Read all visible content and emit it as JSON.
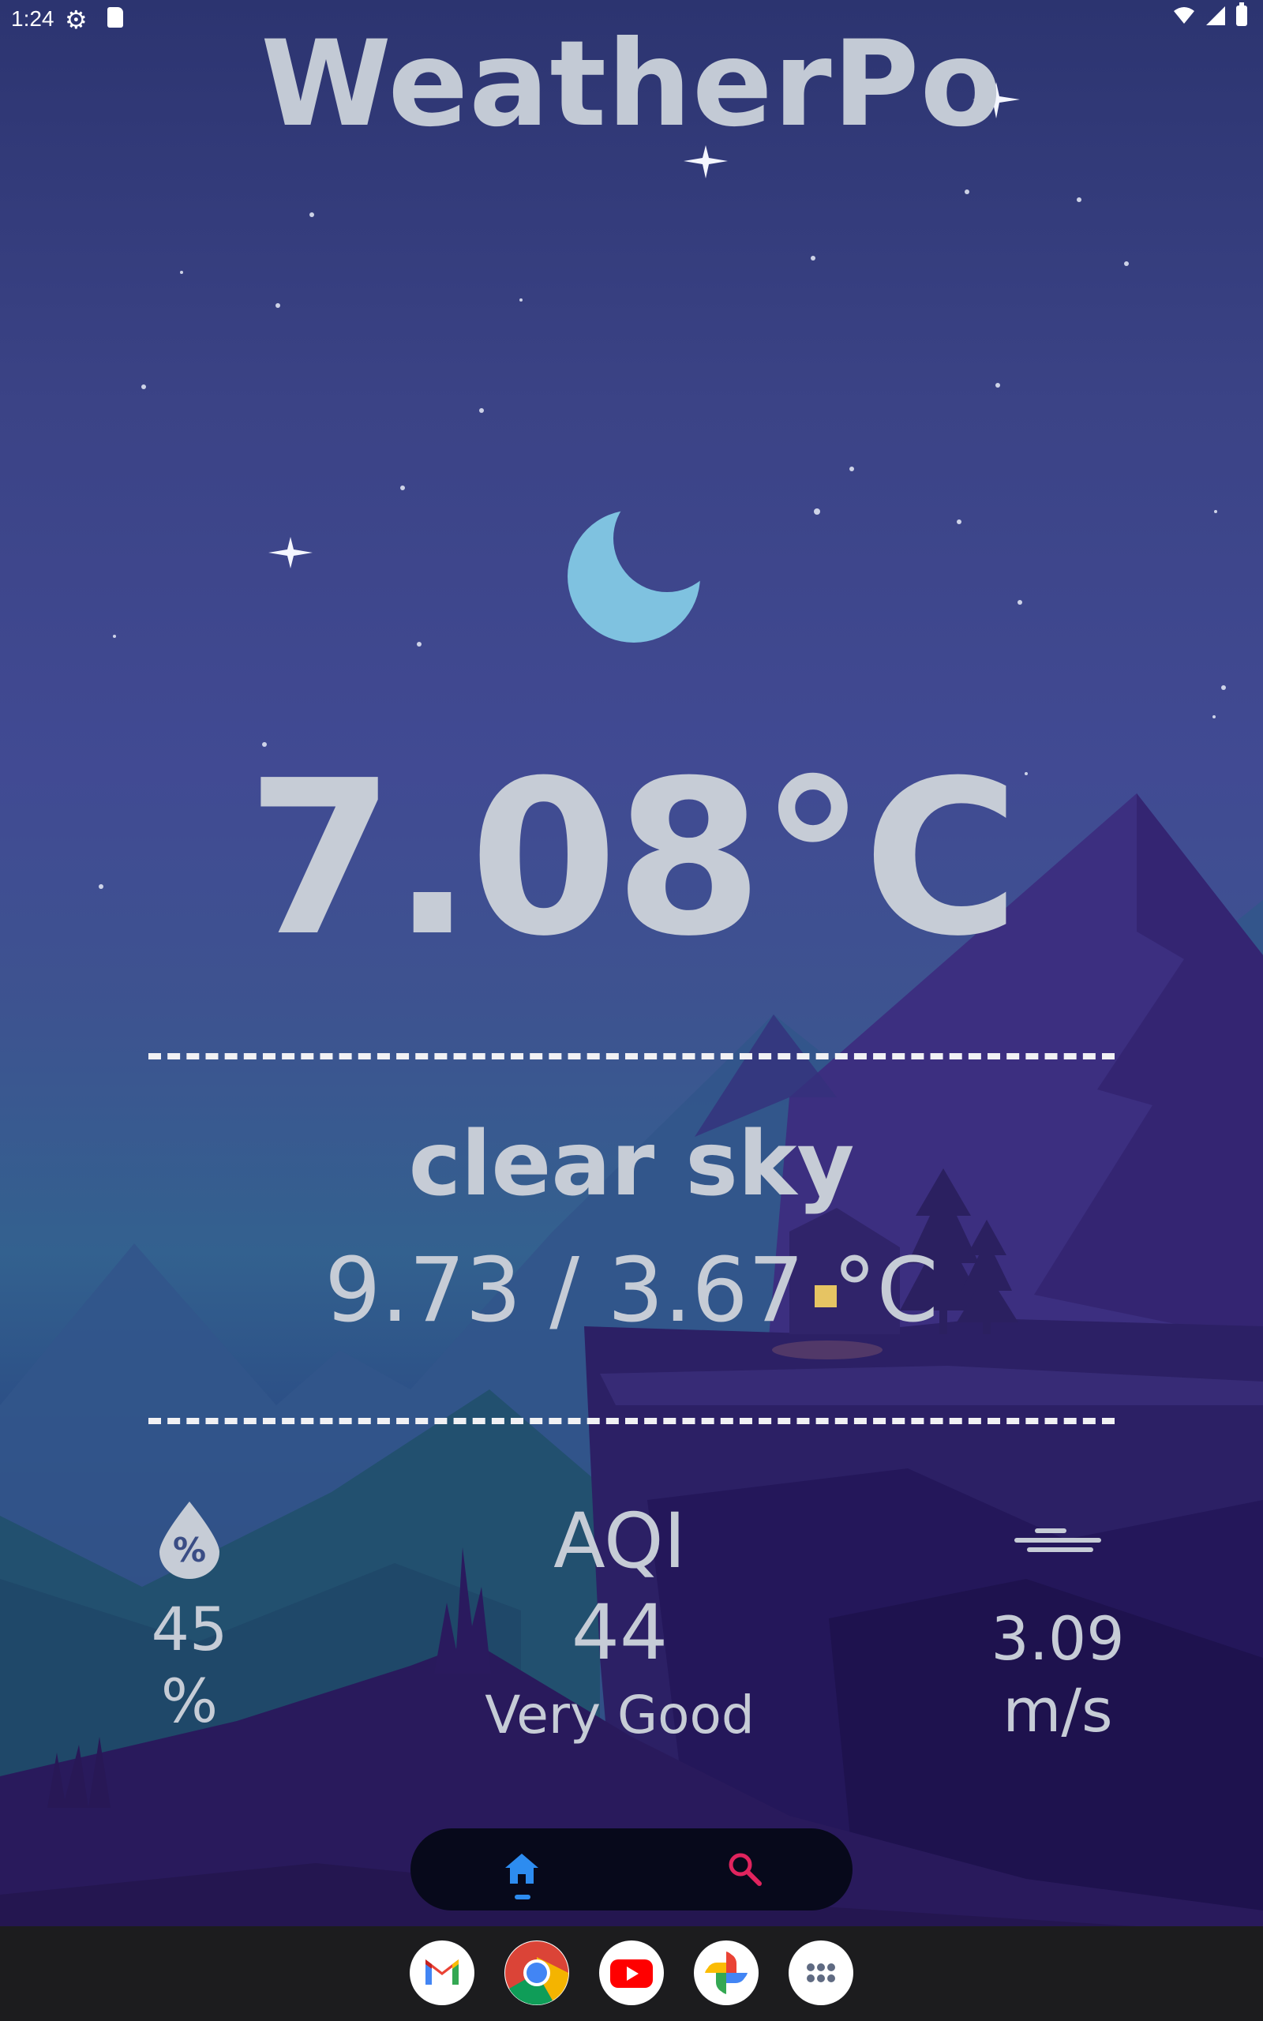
{
  "status_bar": {
    "time": "1:24"
  },
  "app": {
    "title": "WeatherPo"
  },
  "weather": {
    "temperature": "7.08°C",
    "description": "clear sky",
    "min_max": "9.73 / 3.67 °C"
  },
  "stats": {
    "humidity": {
      "value": "45",
      "unit": "%"
    },
    "aqi": {
      "label": "AQI",
      "value": "44",
      "description": "Very Good"
    },
    "wind": {
      "value": "3.09",
      "unit": "m/s"
    }
  },
  "nav": {
    "items": [
      {
        "icon": "home-icon",
        "active": true
      },
      {
        "icon": "search-icon",
        "active": false
      }
    ]
  },
  "dock": {
    "apps": [
      "gmail-icon",
      "chrome-icon",
      "youtube-icon",
      "photos-icon",
      "app-drawer-icon"
    ]
  },
  "colors": {
    "text": "#c6ccd6",
    "moon": "#7fc2e0",
    "nav_active": "#2d8cf0",
    "nav_search": "#e0245e",
    "navbar_bg": "#07091b"
  }
}
